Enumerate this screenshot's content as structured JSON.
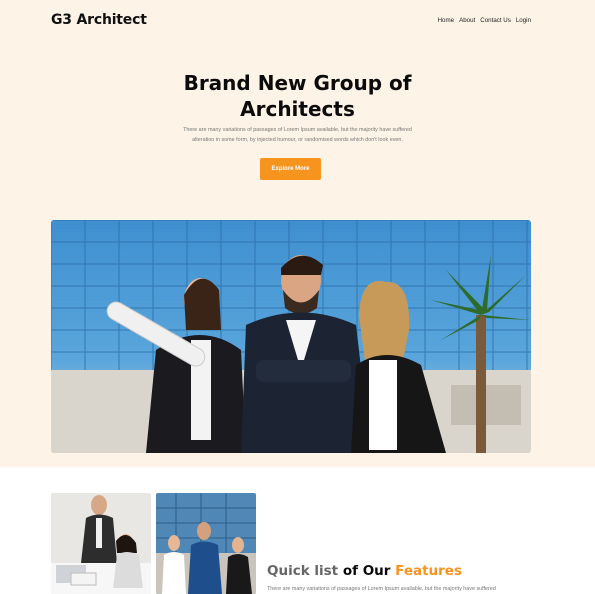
{
  "brand": {
    "logo": "G3 Architect"
  },
  "nav": {
    "items": [
      "Home",
      "About",
      "Contact Us",
      "Login"
    ]
  },
  "hero": {
    "title_line1": "Brand New Group of",
    "title_line2": "Architects",
    "subtitle_line1": "There are many variations of passages of Lorem Ipsum available, but the majority have suffered",
    "subtitle_line2": "alteration in some form, by injected humour, or randomised words which don't look even.",
    "cta_label": "Explore More"
  },
  "features": {
    "title_part1": "Quick list",
    "title_part2": " of Our ",
    "title_part3": "Features",
    "subtitle": "There are many variations of passages of Lorem Ipsum available, but the majority have suffered"
  },
  "colors": {
    "accent": "#f7941d",
    "hero_bg": "#fdf3e7"
  }
}
